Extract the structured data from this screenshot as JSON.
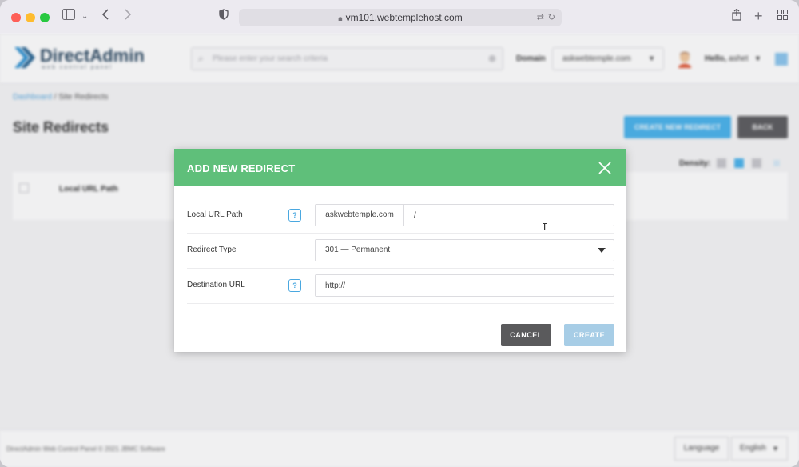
{
  "browser": {
    "url": "vm101.webtemplehost.com"
  },
  "header": {
    "logo_text": "DirectAdmin",
    "logo_sub": "web control panel",
    "search_placeholder": "Please enter your search criteria",
    "domain_label": "Domain",
    "domain_value": "askwebtemple.com",
    "hello_text": "Hello,",
    "username": "ashet"
  },
  "breadcrumb": {
    "root": "Dashboard",
    "separator": " / ",
    "current": "Site Redirects"
  },
  "page": {
    "title": "Site Redirects",
    "create_button": "CREATE NEW REDIRECT",
    "back_button": "BACK",
    "density_label": "Density:",
    "column_header": "Local URL Path"
  },
  "footer": {
    "copyright": "DirectAdmin Web Control Panel © 2021 JBMC Software",
    "language_label": "Language",
    "language_value": "English"
  },
  "modal": {
    "title": "ADD NEW REDIRECT",
    "fields": {
      "local_path": {
        "label": "Local URL Path",
        "help": "?",
        "prefix": "askwebtemple.com",
        "value": "/"
      },
      "redirect_type": {
        "label": "Redirect Type",
        "value": "301 — Permanent"
      },
      "destination": {
        "label": "Destination URL",
        "help": "?",
        "value": "http://"
      }
    },
    "cancel_label": "CANCEL",
    "create_label": "CREATE"
  },
  "colors": {
    "modal_header": "#5fbf7a",
    "primary_blue": "#4ab3ec",
    "create_disabled": "#a7cde6",
    "cancel": "#5a5a5c"
  }
}
